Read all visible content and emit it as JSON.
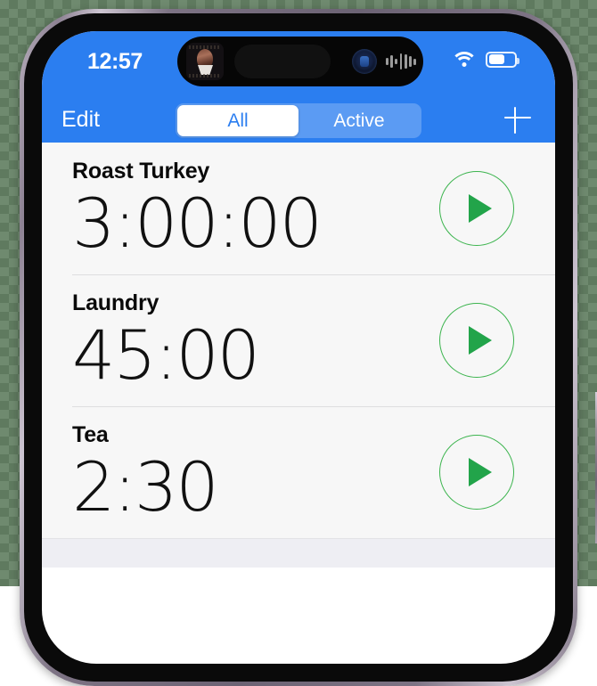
{
  "device": {
    "name": "iphone-frame",
    "frame_color": "#7d7384",
    "bezel_color": "#0a0a0a",
    "hardware_buttons": [
      {
        "name": "action-button",
        "side": "left"
      },
      {
        "name": "volume-up-button",
        "side": "left"
      },
      {
        "name": "volume-down-button",
        "side": "left"
      },
      {
        "name": "power-button",
        "side": "right"
      }
    ]
  },
  "status_bar": {
    "time": "12:57",
    "background_color": "#2b7ef0",
    "wifi_icon": "wifi-icon",
    "battery_icon": "battery-icon",
    "battery_level_percent": 57,
    "dynamic_island": {
      "album_art_icon": "album-artwork-thumbnail",
      "camera_icon": "front-camera-lens",
      "waveform_icon": "audio-waveform-icon",
      "waveform_bars": [
        8,
        14,
        6,
        18,
        16,
        12,
        7
      ]
    }
  },
  "nav_bar": {
    "background_color": "#2b7ef0",
    "edit_label": "Edit",
    "add_icon": "plus-icon",
    "segments": [
      {
        "label": "All",
        "selected": true
      },
      {
        "label": "Active",
        "selected": false
      }
    ],
    "selected_segment_bg": "#ffffff",
    "selected_segment_text_color": "#2b7ef0",
    "track_color": "#5b9bf3"
  },
  "timers": {
    "accent_color": "#3cb44e",
    "play_icon": "play-icon",
    "rows": [
      {
        "label": "Roast Turkey",
        "time": "3:00:00"
      },
      {
        "label": "Laundry",
        "time": "45:00"
      },
      {
        "label": "Tea",
        "time": "2:30"
      }
    ]
  }
}
